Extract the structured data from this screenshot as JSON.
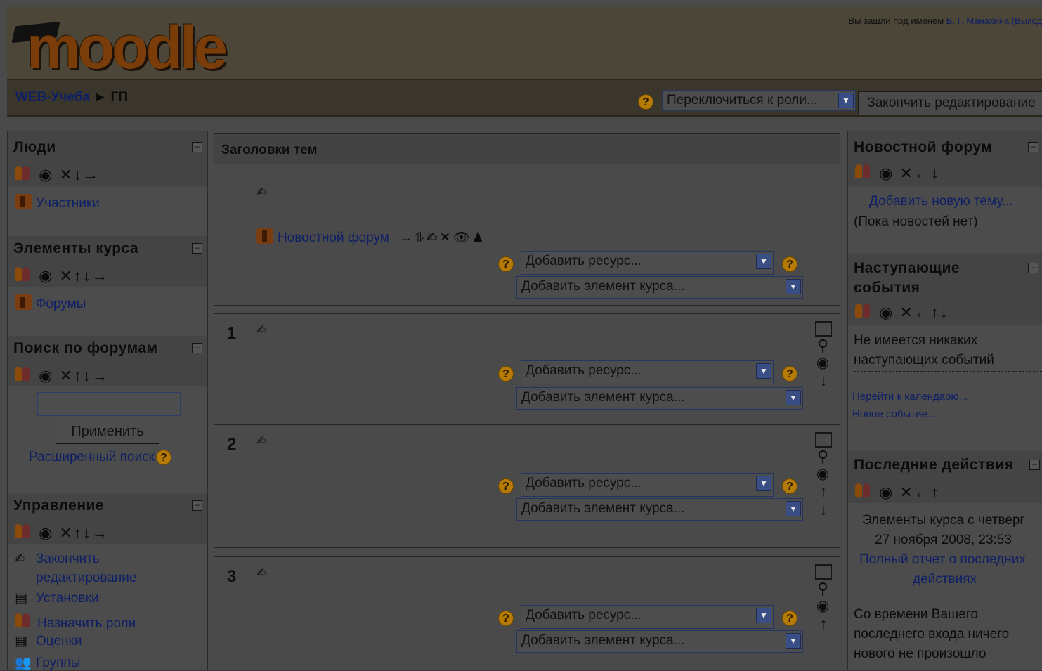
{
  "header": {
    "logo_text": "moodle",
    "login_prefix": "Вы зашли под именем",
    "user_name": "В. Г. Манахина",
    "logout": "(Выход"
  },
  "navbar": {
    "site_link": "WEB-Учеба",
    "separator": "►",
    "course": "ГП",
    "role_select": "Переключиться к роли...",
    "edit_button": "Закончить редактирование"
  },
  "left": {
    "people": {
      "title": "Люди",
      "controls": "✕↓→",
      "items": [
        "Участники"
      ]
    },
    "activities": {
      "title": "Элементы курса",
      "controls": "✕↑↓→",
      "items": [
        "Форумы"
      ]
    },
    "search": {
      "title": "Поиск по форумам",
      "controls": "✕↑↓→",
      "button": "Применить",
      "advanced": "Расширенный поиск"
    },
    "admin": {
      "title": "Управление",
      "controls": "✕↑↓→",
      "items": [
        "Закончить",
        "редактирование",
        "Установки",
        "Назначить роли",
        "Оценки",
        "Группы"
      ]
    }
  },
  "main": {
    "title": "Заголовки тем",
    "section0": {
      "forum_link": "Новостной форум",
      "forum_controls": "→⥮✍✕👁♟"
    },
    "sections": [
      {
        "num": "1"
      },
      {
        "num": "2"
      },
      {
        "num": "3"
      }
    ],
    "add_resource": "Добавить ресурс...",
    "add_activity": "Добавить элемент курса..."
  },
  "right": {
    "news": {
      "title": "Новостной форум",
      "controls": "✕←↓",
      "add_topic": "Добавить новую тему...",
      "no_news": "(Пока новостей нет)"
    },
    "events": {
      "title_line1": "Наступающие",
      "title_line2": "события",
      "controls": "✕←↑↓",
      "none_line1": "Не имеется никаких",
      "none_line2": "наступающих событий",
      "calendar": "Перейти к календарю...",
      "new_event": "Новое событие..."
    },
    "recent": {
      "title": "Последние действия",
      "controls": "✕←↑",
      "line1": "Элементы курса с четверг",
      "line2": "27 ноября 2008, 23:53",
      "report1": "Полный отчет о последних",
      "report2": "действиях",
      "msg1": "Со времени Вашего",
      "msg2": "последнего входа ничего",
      "msg3": "нового не произошло"
    }
  }
}
